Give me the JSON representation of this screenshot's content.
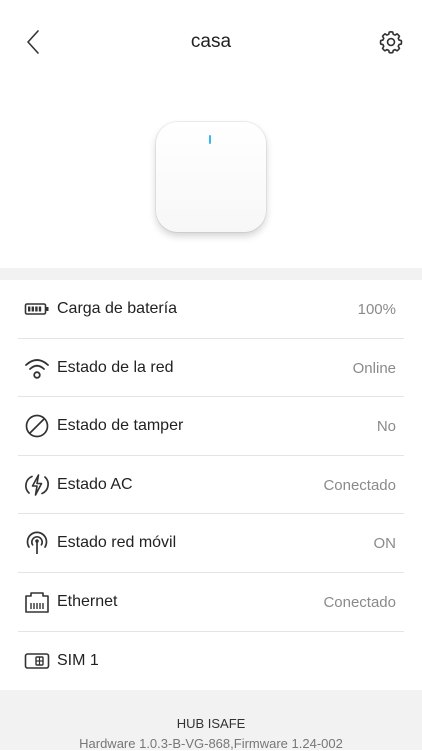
{
  "header": {
    "title": "casa",
    "back_icon": "chevron-left-icon",
    "settings_icon": "gear-icon"
  },
  "device": {
    "led_color": "#38b7f0"
  },
  "status_rows": [
    {
      "icon": "battery-icon",
      "label": "Carga de batería",
      "value": "100%"
    },
    {
      "icon": "wifi-icon",
      "label": "Estado de la red",
      "value": "Online"
    },
    {
      "icon": "tamper-icon",
      "label": "Estado de tamper",
      "value": "No"
    },
    {
      "icon": "power-ac-icon",
      "label": "Estado AC",
      "value": "Conectado"
    },
    {
      "icon": "antenna-icon",
      "label": "Estado red móvil",
      "value": "ON"
    },
    {
      "icon": "ethernet-icon",
      "label": "Ethernet",
      "value": "Conectado"
    },
    {
      "icon": "sim-card-icon",
      "label": "SIM 1",
      "value": ""
    }
  ],
  "footer": {
    "model": "HUB ISAFE",
    "hardware": "Hardware 1.0.3-B-VG-868,Firmware 1.24-002"
  }
}
